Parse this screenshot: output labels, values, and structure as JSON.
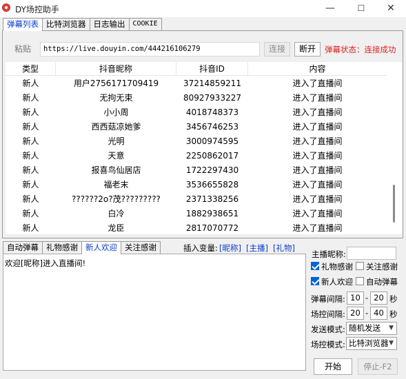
{
  "window": {
    "title": "DY场控助手",
    "min": "—",
    "max": "☐",
    "close": "✕"
  },
  "tabs_top": [
    "弹幕列表",
    "比特浏览器",
    "日志输出",
    "COOKIE"
  ],
  "url_bar": {
    "paste": "粘贴",
    "url": "https://live.douyin.com/444216106279",
    "connect": "连接",
    "disconnect": "断开",
    "status": "弹幕状态：连接成功"
  },
  "table": {
    "columns": [
      "类型",
      "抖音昵称",
      "抖音ID",
      "内容"
    ],
    "rows": [
      [
        "新人",
        "用户2756171709419",
        "37214859211",
        "进入了直播间"
      ],
      [
        "新人",
        "无拘无束",
        "80927933227",
        "进入了直播间"
      ],
      [
        "新人",
        "小小周",
        "4018748373",
        "进入了直播间"
      ],
      [
        "新人",
        "西西菇凉她爹",
        "3456746253",
        "进入了直播间"
      ],
      [
        "新人",
        "光明",
        "3000974595",
        "进入了直播间"
      ],
      [
        "新人",
        "天意",
        "2250862017",
        "进入了直播间"
      ],
      [
        "新人",
        "报喜鸟仙居店",
        "1722297430",
        "进入了直播间"
      ],
      [
        "新人",
        "福老末",
        "3536655828",
        "进入了直播间"
      ],
      [
        "新人",
        "??????2o?茂?????????",
        "2371338256",
        "进入了直播间"
      ],
      [
        "新人",
        "白冷",
        "1882938651",
        "进入了直播间"
      ],
      [
        "新人",
        "龙臣",
        "2817070772",
        "进入了直播间"
      ]
    ]
  },
  "tabs_bottom": [
    "自动弹幕",
    "礼物感谢",
    "新人欢迎",
    "关注感谢"
  ],
  "insert": {
    "label": "插入变量:",
    "vars": [
      "[昵称]",
      "[主播]",
      "[礼物]"
    ]
  },
  "message": "欢迎[昵称]进入直播间!",
  "settings": {
    "anchor_label": "主播昵称:",
    "anchor_value": "",
    "gift_thanks": "礼物感谢",
    "follow_thanks": "关注感谢",
    "new_welcome": "新人欢迎",
    "auto_barrage": "自动弹幕",
    "barrage_interval_label": "弹幕间隔:",
    "barrage_min": "10",
    "barrage_max": "20",
    "control_interval_label": "场控间隔:",
    "control_min": "20",
    "control_max": "40",
    "dash": "-",
    "seconds": "秒",
    "send_mode_label": "发送模式:",
    "send_mode": "随机发送",
    "control_mode_label": "场控模式:",
    "control_mode": "比特浏览器",
    "start": "开始",
    "stop": "停止-F2"
  },
  "colors": {
    "accent": "#0a3ccf",
    "status": "#e02020",
    "check": "#0063d6"
  }
}
